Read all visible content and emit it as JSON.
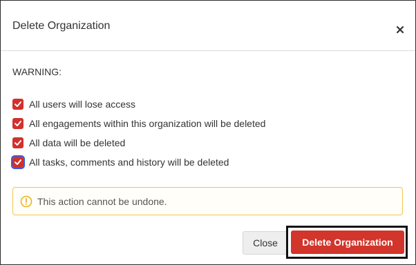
{
  "dialog": {
    "title": "Delete Organization",
    "close_icon": "close-icon"
  },
  "warning": {
    "label": "WARNING:",
    "items": [
      {
        "label": "All users will lose access",
        "checked": true
      },
      {
        "label": "All engagements within this organization will be deleted",
        "checked": true
      },
      {
        "label": "All data will be deleted",
        "checked": true
      },
      {
        "label": "All tasks, comments and history will be deleted",
        "checked": true
      }
    ]
  },
  "alert": {
    "icon": "warning-circle-icon",
    "text": "This action cannot be undone."
  },
  "footer": {
    "close_label": "Close",
    "delete_label": "Delete Organization"
  },
  "colors": {
    "danger": "#d2352b",
    "alert_border": "#f0c64a",
    "focus": "#3b5bdb"
  }
}
